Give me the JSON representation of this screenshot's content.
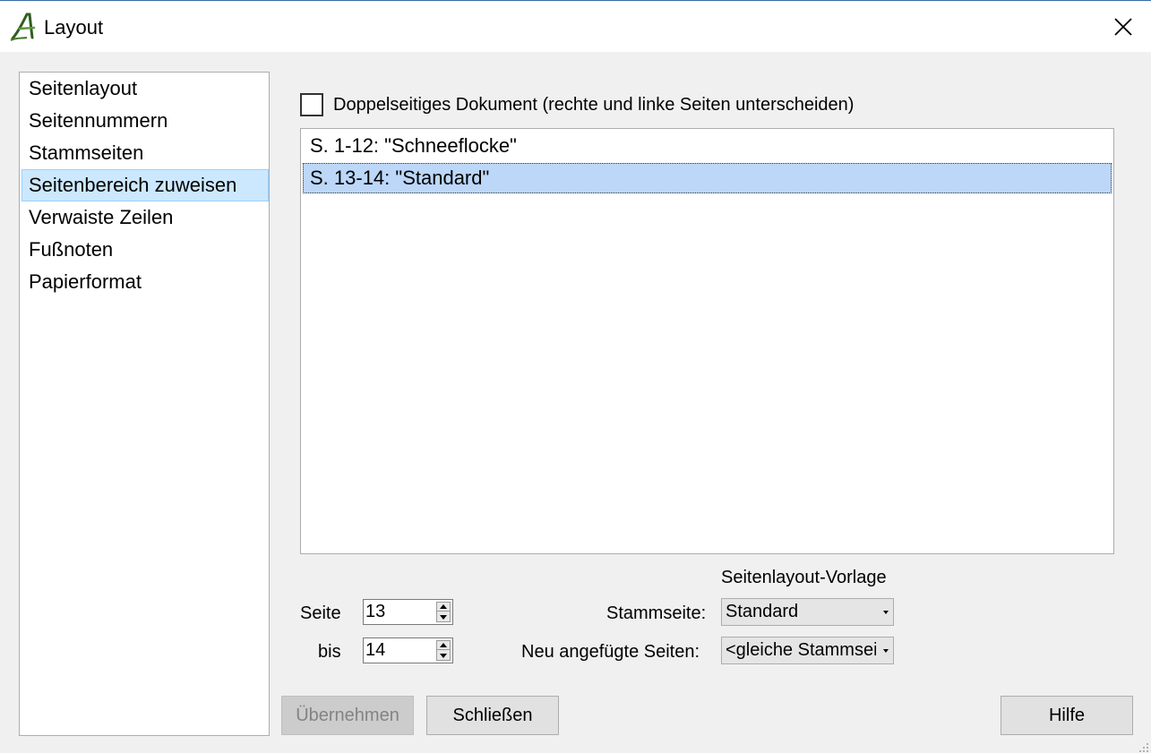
{
  "window": {
    "title": "Layout"
  },
  "sidebar": {
    "items": [
      {
        "label": "Seitenlayout"
      },
      {
        "label": "Seitennummern"
      },
      {
        "label": "Stammseiten"
      },
      {
        "label": "Seitenbereich zuweisen",
        "selected": true
      },
      {
        "label": "Verwaiste Zeilen"
      },
      {
        "label": "Fußnoten"
      },
      {
        "label": "Papierformat"
      }
    ]
  },
  "main": {
    "double_sided_label": "Doppelseitiges Dokument (rechte und linke Seiten unterscheiden)",
    "double_sided_checked": false,
    "ranges": [
      {
        "label": "S. 1-12: \"Schneeflocke\""
      },
      {
        "label": "S. 13-14: \"Standard\"",
        "selected": true
      }
    ],
    "page_label": "Seite",
    "page_value": "13",
    "to_label": "bis",
    "to_value": "14",
    "template_heading": "Seitenlayout-Vorlage",
    "master_label": "Stammseite:",
    "master_value": "Standard",
    "new_pages_label": "Neu angefügte Seiten:",
    "new_pages_value": "<gleiche Stammseite>"
  },
  "buttons": {
    "apply": "Übernehmen",
    "close": "Schließen",
    "help": "Hilfe"
  },
  "icons": {
    "app": "app-logo-icon",
    "close": "close-icon",
    "spin_up": "arrow-up-icon",
    "spin_down": "arrow-down-icon",
    "dropdown": "chevron-down-icon",
    "grip": "resize-grip-icon"
  },
  "colors": {
    "selection": "#cce8ff",
    "list_selection": "#bcd7f8",
    "logo_green": "#3e7a2b"
  }
}
